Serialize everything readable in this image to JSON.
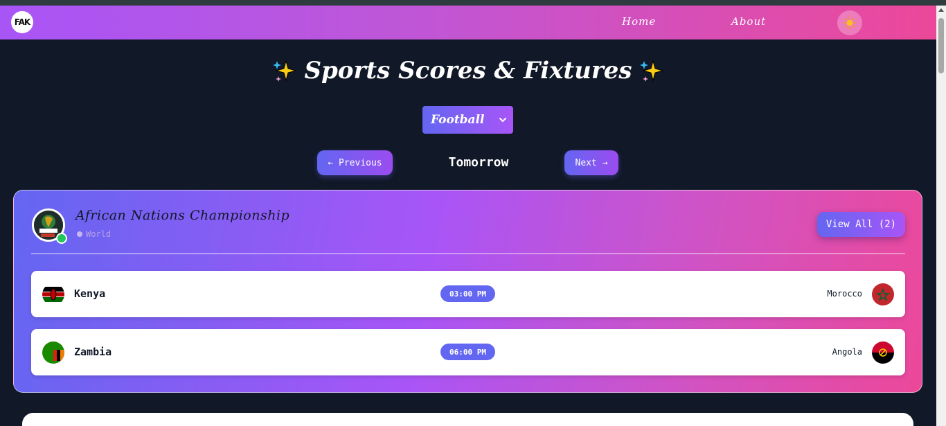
{
  "navbar": {
    "logo_text": "FAK",
    "links": [
      {
        "label": "Home"
      },
      {
        "label": "About"
      }
    ],
    "theme_icon": "sun-icon"
  },
  "page": {
    "title": "Sports Scores & Fixtures",
    "title_icon": "sparkles-icon"
  },
  "sport_select": {
    "selected": "Football",
    "icon": "chevron-down-icon"
  },
  "date_nav": {
    "previous_label": "← Previous",
    "current_label": "Tomorrow",
    "next_label": "Next →"
  },
  "league": {
    "name": "African Nations Championship",
    "region": "World",
    "view_all_label": "View All (2)",
    "status_color": "#22c55e",
    "matches": [
      {
        "home": "Kenya",
        "time": "03:00 PM",
        "away": "Morocco",
        "home_flag": "kenya-flag-icon",
        "away_flag": "morocco-flag-icon"
      },
      {
        "home": "Zambia",
        "time": "06:00 PM",
        "away": "Angola",
        "home_flag": "zambia-flag-icon",
        "away_flag": "angola-flag-icon"
      }
    ]
  },
  "colors": {
    "background": "#111827",
    "accent_start": "#6366f1",
    "accent_mid": "#a855f7",
    "accent_end": "#ec4899"
  }
}
